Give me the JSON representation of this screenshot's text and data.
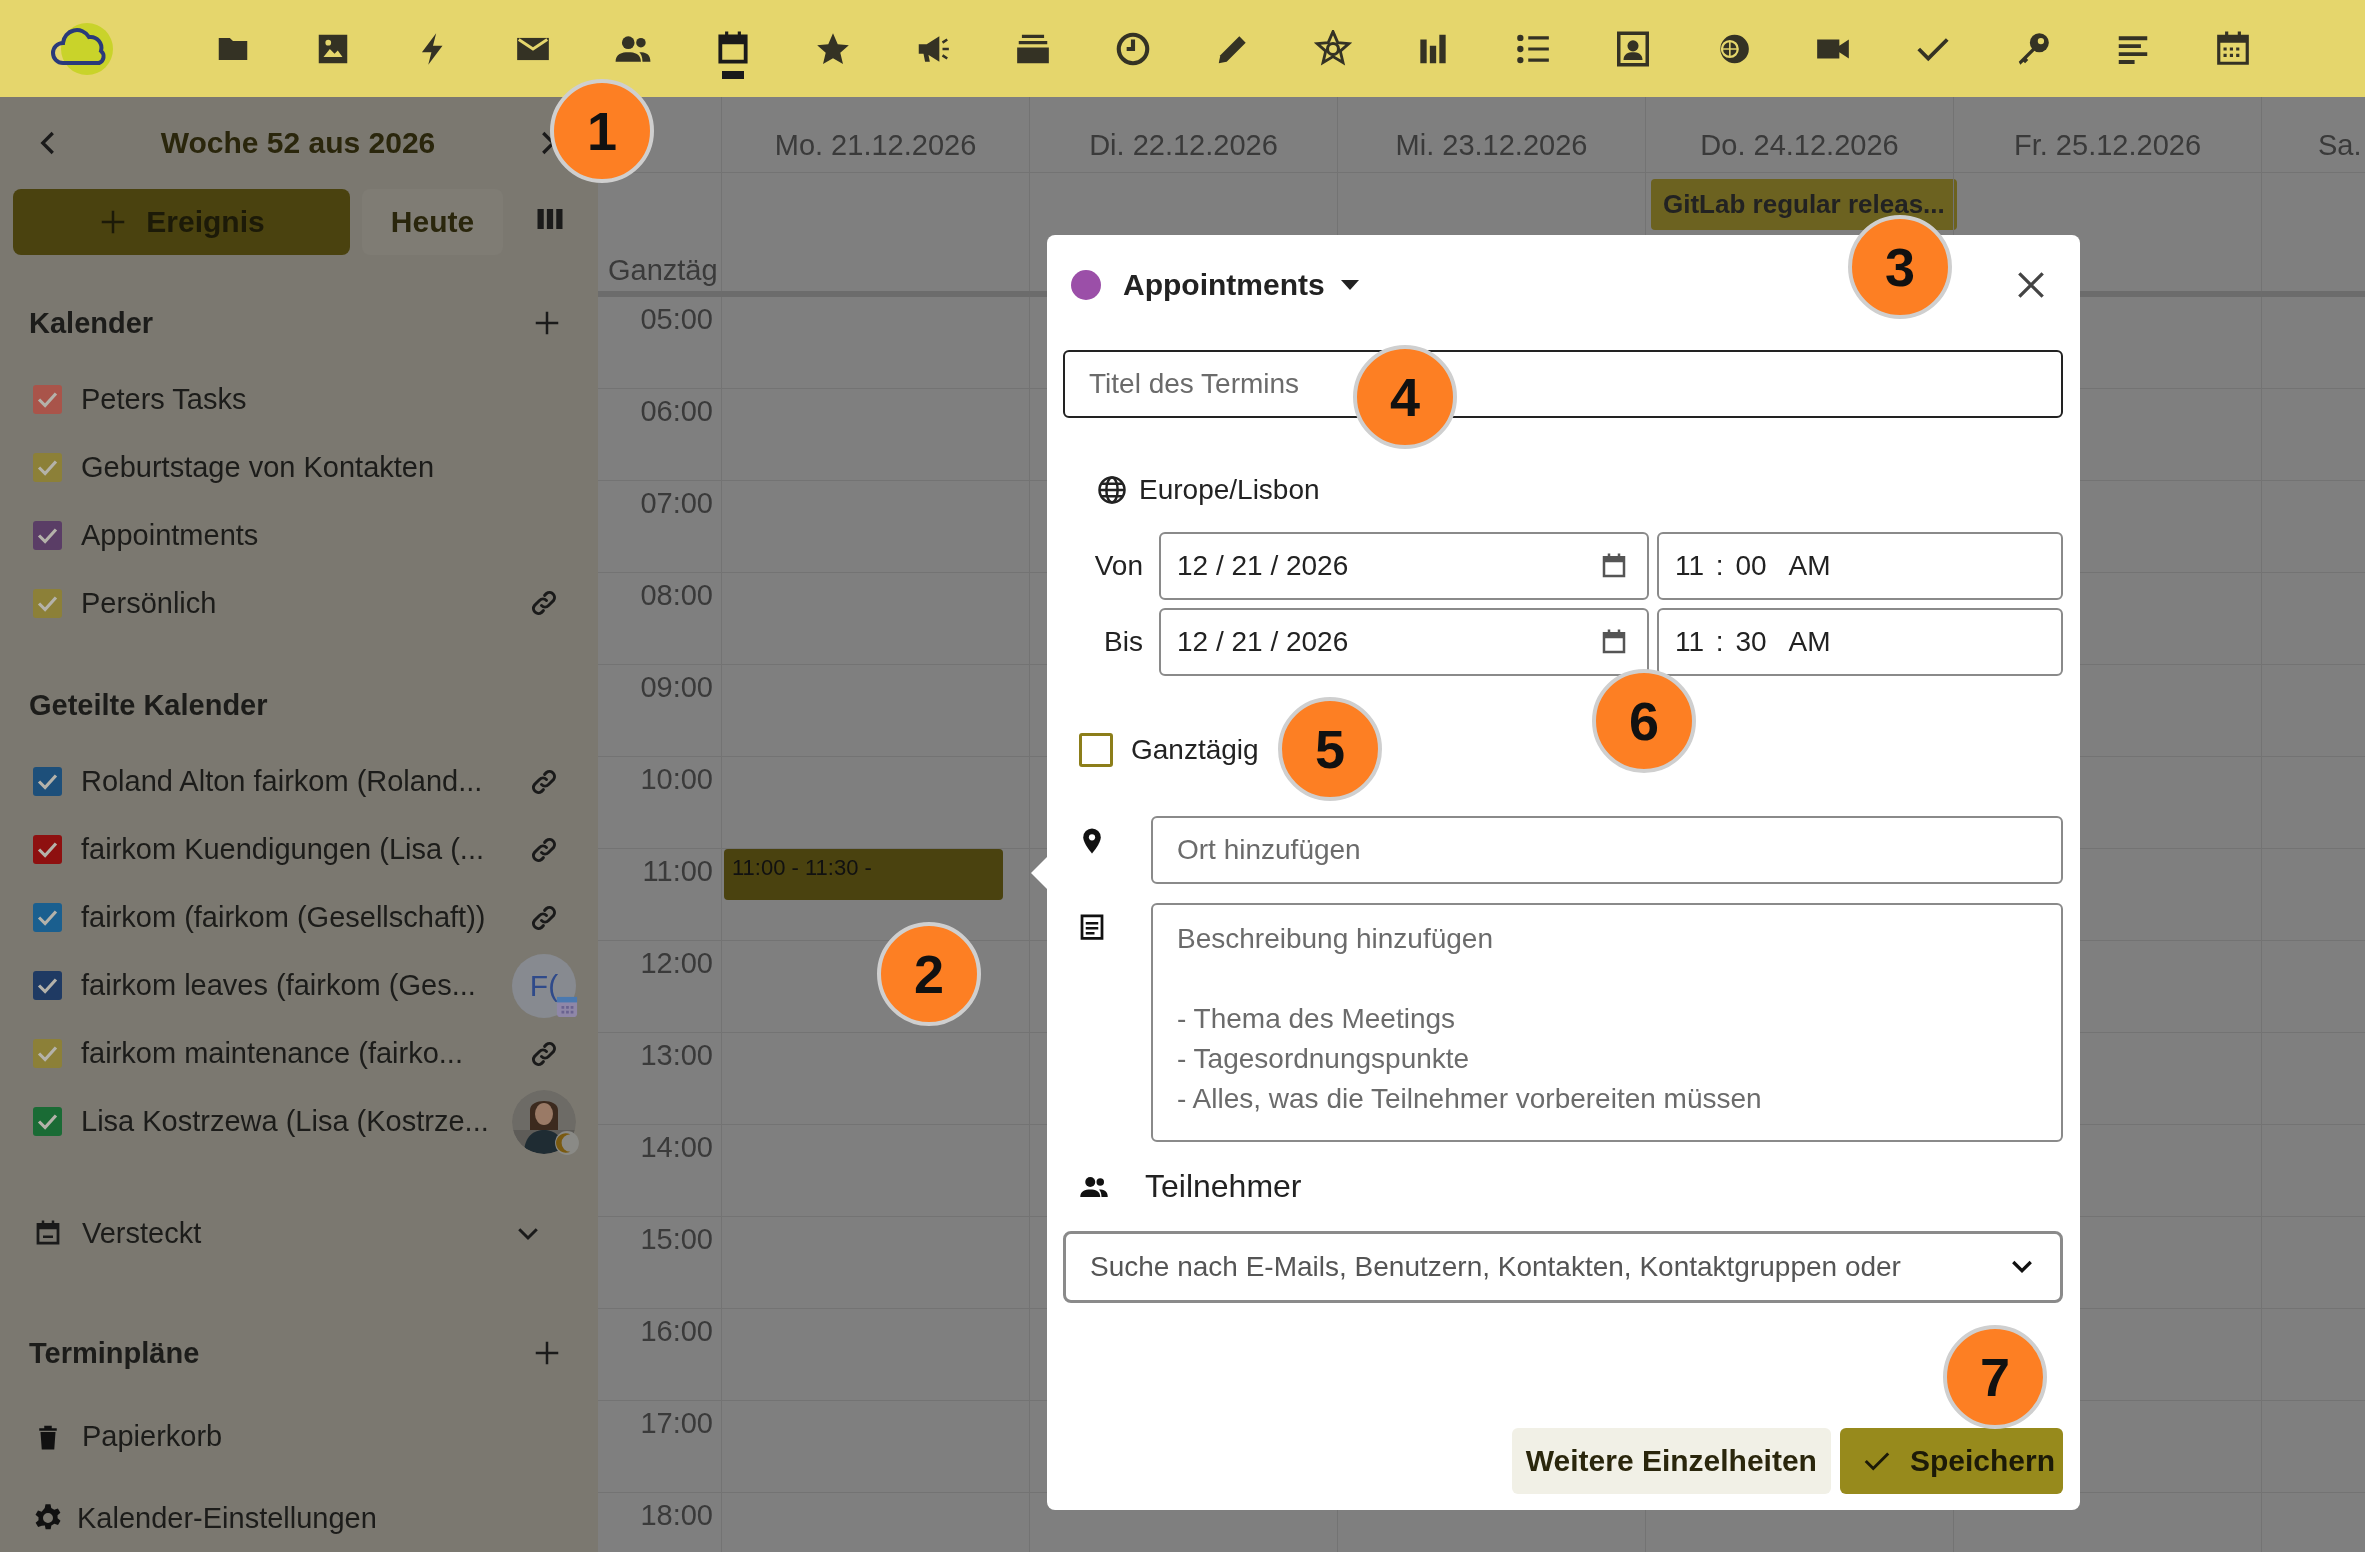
{
  "top_bar": {
    "apps": [
      {
        "selected": false
      },
      {
        "selected": false
      },
      {
        "selected": false
      },
      {
        "selected": false
      },
      {
        "selected": false
      },
      {
        "selected": true
      },
      {
        "selected": false
      },
      {
        "selected": false
      },
      {
        "selected": false
      },
      {
        "selected": false
      },
      {
        "selected": false
      },
      {
        "selected": false
      },
      {
        "selected": false
      },
      {
        "selected": false
      },
      {
        "selected": false
      },
      {
        "selected": false
      },
      {
        "selected": false
      },
      {
        "selected": false
      },
      {
        "selected": false
      },
      {
        "selected": false
      },
      {
        "selected": false
      }
    ]
  },
  "sidebar": {
    "week_title": "Woche 52 aus 2026",
    "new_event_button": "Ereignis",
    "today_button": "Heute",
    "calendars_heading": "Kalender",
    "calendars": [
      {
        "name": "Peters Tasks",
        "color": "#a9544a",
        "checked": true,
        "kind": "plain"
      },
      {
        "name": "Geburtstage von Kontakten",
        "color": "#8c8038",
        "checked": true,
        "kind": "plain"
      },
      {
        "name": "Appointments",
        "color": "#5a3d66",
        "checked": true,
        "kind": "plain"
      },
      {
        "name": "Persönlich",
        "color": "#8c8038",
        "checked": true,
        "kind": "link"
      }
    ],
    "shared_heading": "Geteilte Kalender",
    "shared_calendars": [
      {
        "name": "Roland Alton fairkom (Roland...",
        "color": "#1d4f7a",
        "checked": true,
        "kind": "link"
      },
      {
        "name": "fairkom Kuendigungen (Lisa (...",
        "color": "#8e1010",
        "checked": true,
        "kind": "link"
      },
      {
        "name": "fairkom (fairkom (Gesellschaft))",
        "color": "#1a5f8f",
        "checked": true,
        "kind": "link"
      },
      {
        "name": "fairkom leaves (fairkom (Ges...",
        "color": "#1f3a63",
        "checked": true,
        "kind": "initials",
        "avatar_text": "F("
      },
      {
        "name": "fairkom maintenance (fairko...",
        "color": "#8c8038",
        "checked": true,
        "kind": "link"
      },
      {
        "name": "Lisa Kostrzewa (Lisa (Kostrze...",
        "color": "#1a6b35",
        "checked": true
      }
    ],
    "hidden_section": "Versteckt",
    "schedules_heading": "Terminpläne",
    "trash": "Papierkorb",
    "settings": "Kalender-Einstellungen"
  },
  "calendar": {
    "allday_label": "Ganztäg",
    "days": [
      {
        "label": "Mo. 21.12.2026"
      },
      {
        "label": "Di. 22.12.2026"
      },
      {
        "label": "Mi. 23.12.2026"
      },
      {
        "label": "Do. 24.12.2026",
        "allday_event": "GitLab regular releas..."
      },
      {
        "label": "Fr. 25.12.2026"
      },
      {
        "label": "Sa."
      }
    ],
    "hours": [
      {
        "label": "05:00"
      },
      {
        "label": "06:00"
      },
      {
        "label": "07:00"
      },
      {
        "label": "08:00"
      },
      {
        "label": "09:00"
      },
      {
        "label": "10:00"
      },
      {
        "label": "11:00",
        "event_cells": [
          {
            "text": "11:00 - 11:30 -"
          }
        ]
      },
      {
        "label": "12:00"
      },
      {
        "label": "13:00"
      },
      {
        "label": "14:00"
      },
      {
        "label": "15:00"
      },
      {
        "label": "16:00"
      },
      {
        "label": "17:00"
      },
      {
        "label": "18:00"
      }
    ]
  },
  "dialog": {
    "calendar_name": "Appointments",
    "color": "#9b4fa8",
    "title_placeholder": "Titel des Termins",
    "timezone": "Europe/Lisbon",
    "from_label": "Von",
    "from_date": "12 / 21 / 2026",
    "from_time": "11 : 00  AM",
    "to_label": "Bis",
    "to_date": "12 / 21 / 2026",
    "to_time": "11 : 30  AM",
    "all_day": {
      "label": "Ganztägig",
      "checked": false
    },
    "location_placeholder": "Ort hinzufügen",
    "description_placeholder": "Beschreibung hinzufügen\n\n- Thema des Meetings\n- Tagesordnungspunkte\n- Alles, was die Teilnehmer vorbereiten müssen",
    "attendees_label": "Teilnehmer",
    "attendee_search_placeholder": "Suche nach E-Mails, Benutzern, Kontakten, Kontaktgruppen oder",
    "more_button": "Weitere Einzelheiten",
    "save_button": "Speichern"
  },
  "callouts": [
    "1",
    "2",
    "3",
    "4",
    "5",
    "6",
    "7"
  ]
}
